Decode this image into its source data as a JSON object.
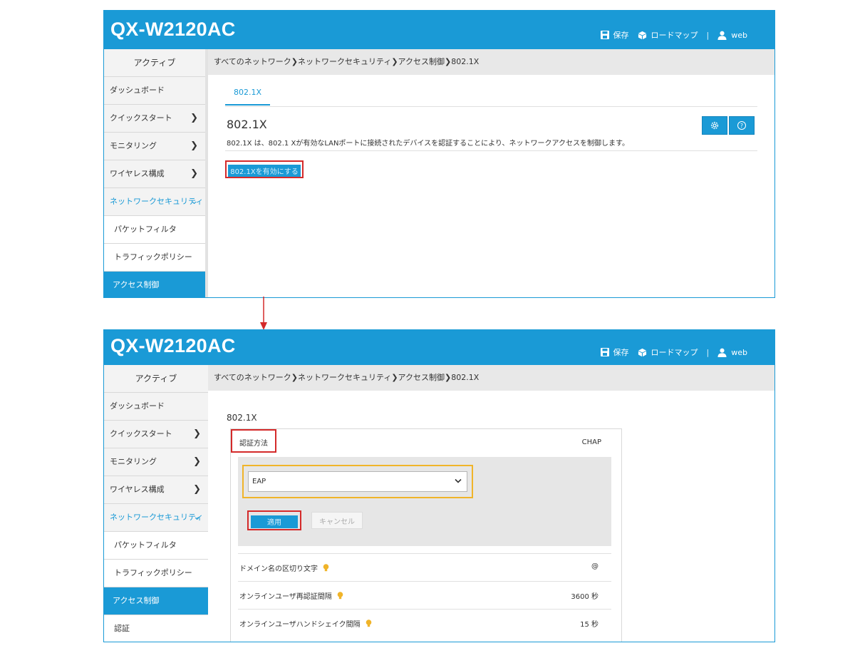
{
  "app_title": "QX-W2120AC",
  "header": {
    "save_label": "保存",
    "roadmap_label": "ロードマップ",
    "separator": "|",
    "user": "web"
  },
  "sidebar": {
    "active_heading": "アクティブ",
    "items": [
      "ダッシュボード",
      "クイックスタート",
      "モニタリング",
      "ワイヤレス構成",
      "ネットワークセキュリティ"
    ],
    "sub_items": [
      "パケットフィルタ",
      "トラフィックポリシー",
      "アクセス制御",
      "認証"
    ]
  },
  "breadcrumb": "すべてのネットワーク❯ネットワークセキュリティ❯アクセス制御❯802.1X",
  "top_screen": {
    "tab_label": "802.1X",
    "section_title": "802.1X",
    "description": "802.1X は、802.1 Xが有効なLANポートに接続されたデバイスを認証することにより、ネットワークアクセスを制御します。",
    "enable_button": "802.1Xを有効にする"
  },
  "bottom_screen": {
    "section_title": "802.1X",
    "auth_method_label": "認証方法",
    "auth_method_value": "CHAP",
    "select_value": "EAP",
    "apply_button": "適用",
    "cancel_button": "キャンセル",
    "rows": [
      {
        "label": "ドメイン名の区切り文字",
        "value": "@"
      },
      {
        "label": "オンラインユーザ再認証間隔",
        "value": "3600 秒"
      },
      {
        "label": "オンラインユーザハンドシェイク間隔",
        "value": "15 秒"
      }
    ]
  },
  "colors": {
    "brand": "#1a9ad6",
    "highlight_red": "#d42a2a",
    "highlight_yellow": "#f0b429",
    "tip_icon": "#f0b429"
  },
  "icons": [
    "save-icon",
    "box-icon",
    "user-icon",
    "gear-icon",
    "help-icon",
    "chevron-right-icon",
    "chevron-down-icon",
    "lightbulb-icon",
    "arrow-down-icon"
  ]
}
